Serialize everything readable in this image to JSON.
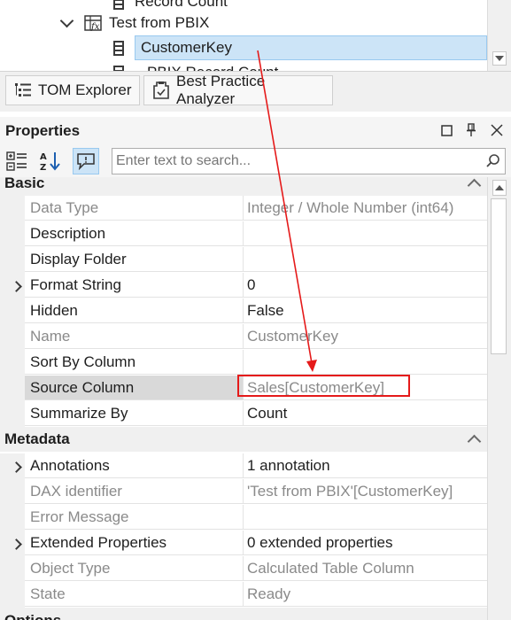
{
  "tree": {
    "partial_item": "Record Count",
    "table_name": "Test from PBIX",
    "selected_column": "CustomerKey",
    "next_item_partial": "PBIX Record Count"
  },
  "tabs": [
    {
      "label": "TOM Explorer"
    },
    {
      "label": "Best Practice Analyzer"
    }
  ],
  "properties": {
    "title": "Properties",
    "search_placeholder": "Enter text to search..."
  },
  "categories": {
    "basic": "Basic",
    "metadata": "Metadata",
    "options_partial": "Options"
  },
  "basic_rows": [
    {
      "name": "Data Type",
      "value": "Integer / Whole Number (int64)"
    },
    {
      "name": "Description",
      "value": ""
    },
    {
      "name": "Display Folder",
      "value": ""
    },
    {
      "name": "Format String",
      "value": "0"
    },
    {
      "name": "Hidden",
      "value": "False"
    },
    {
      "name": "Name",
      "value": "CustomerKey"
    },
    {
      "name": "Sort By Column",
      "value": ""
    },
    {
      "name": "Source Column",
      "value": "Sales[CustomerKey]"
    },
    {
      "name": "Summarize By",
      "value": "Count"
    }
  ],
  "metadata_rows": [
    {
      "name": "Annotations",
      "value": "1 annotation"
    },
    {
      "name": "DAX identifier",
      "value": "'Test from PBIX'[CustomerKey]"
    },
    {
      "name": "Error Message",
      "value": ""
    },
    {
      "name": "Extended Properties",
      "value": "0 extended properties"
    },
    {
      "name": "Object Type",
      "value": "Calculated Table Column"
    },
    {
      "name": "State",
      "value": "Ready"
    }
  ],
  "colors": {
    "selection": "#cce4f7",
    "annotation_red": "#e51a1a",
    "readonly_text": "#8a8a8a"
  }
}
